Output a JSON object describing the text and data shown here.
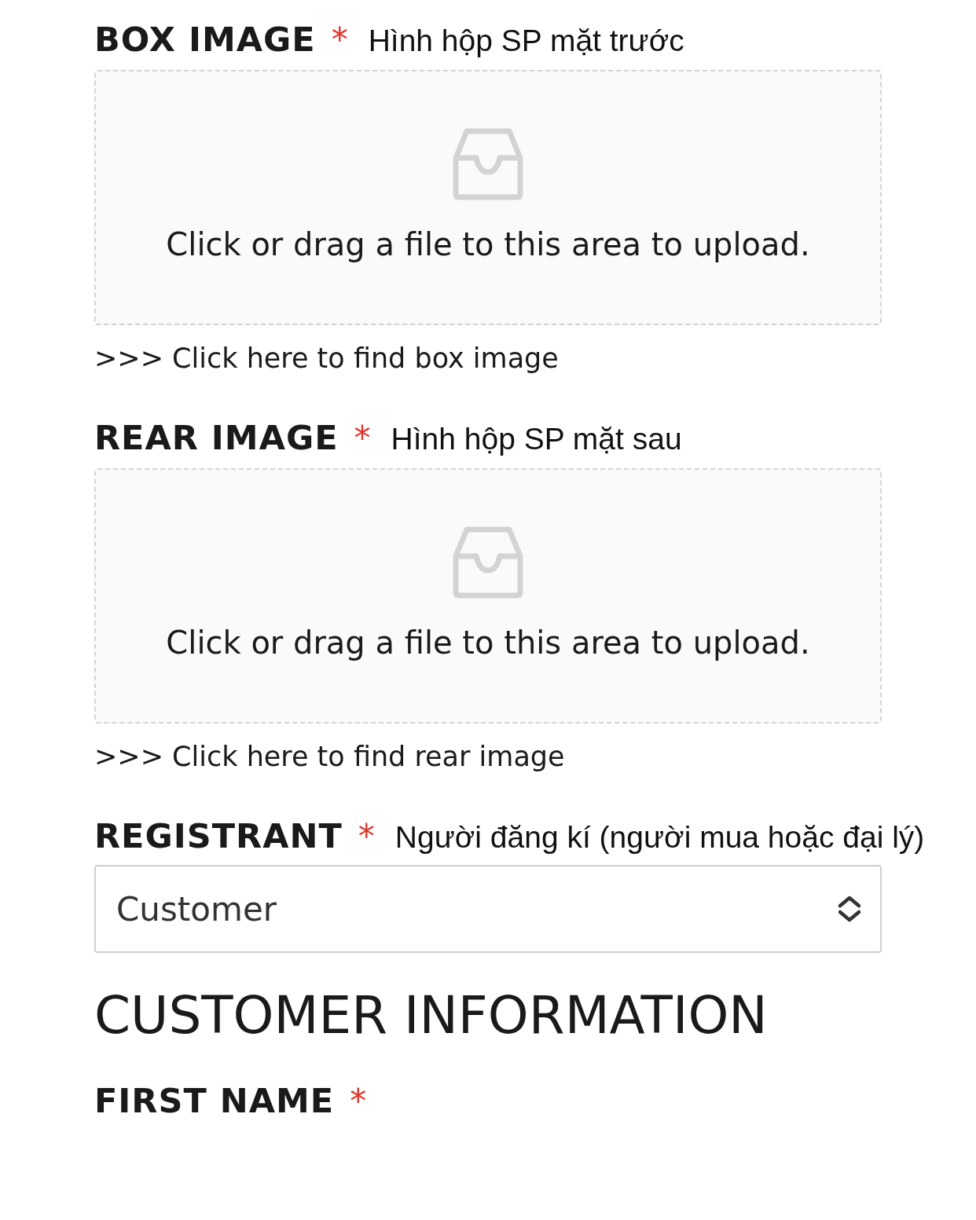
{
  "fields": [
    {
      "kind": "upload",
      "label": "BOX IMAGE",
      "required_mark": "*",
      "note": "Hình hộp SP mặt trước",
      "hint": "Click or drag a file to this area to upload.",
      "link": ">>> Click here to find box image"
    },
    {
      "kind": "upload",
      "label": "REAR IMAGE",
      "required_mark": "*",
      "note": "Hình hộp SP mặt sau",
      "hint": "Click or drag a file to this area to upload.",
      "link": ">>> Click here to find rear image"
    },
    {
      "kind": "select",
      "label": "REGISTRANT",
      "required_mark": "*",
      "note": "Người đăng kí (người mua hoặc đại lý)",
      "value": "Customer"
    }
  ],
  "section_title": "CUSTOMER INFORMATION",
  "next_field": {
    "label": "FIRST NAME",
    "required_mark": "*"
  }
}
